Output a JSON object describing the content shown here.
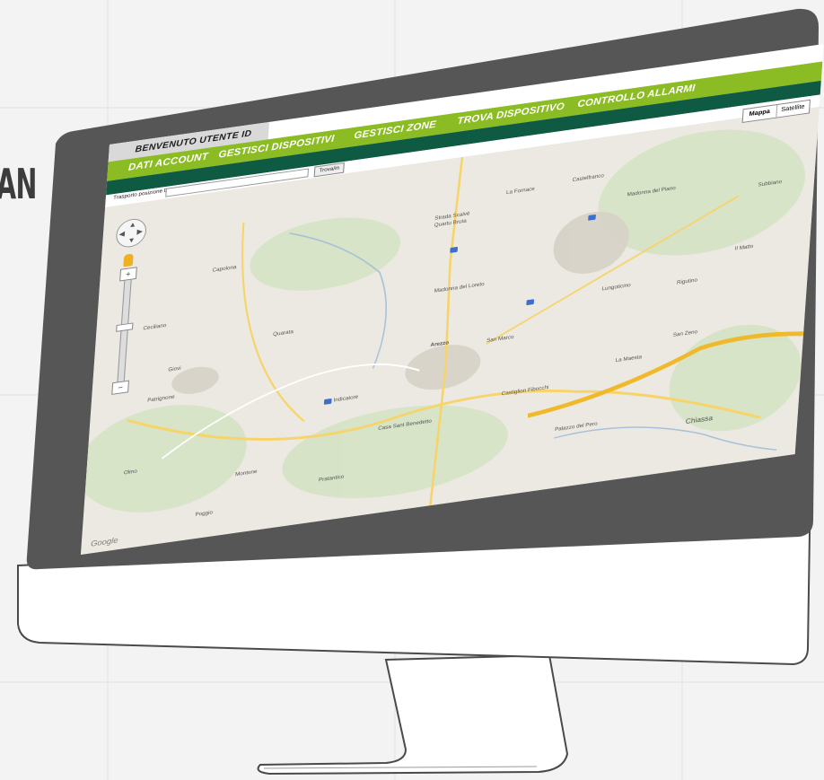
{
  "side_text": "AN",
  "header": {
    "welcome": "BENVENUTO UTENTE ID",
    "nav": [
      {
        "label": "DATI ACCOUNT"
      },
      {
        "label": "GESTISCI DISPOSITIVI"
      },
      {
        "label": "GESTISCI ZONE"
      },
      {
        "label": "TROVA DISPOSITIVO"
      },
      {
        "label": "CONTROLLO ALLARMI"
      }
    ]
  },
  "search": {
    "label": "Trasporto posizione Da",
    "button": "Trova/in"
  },
  "map_type": {
    "map": "Mappa",
    "satellite": "Satellite"
  },
  "map": {
    "attribution": "Google",
    "places": [
      "La Fornace",
      "Castelfranco",
      "Strada Scalvé",
      "Quartu Bruta",
      "Madonna del Piano",
      "Madonna del Loreto",
      "Arezzo",
      "San Marco",
      "Lungoticino",
      "Casa Sant Benedetto",
      "Chiassa",
      "Rigutino",
      "Poggio",
      "Capolona",
      "Giovi",
      "Montone",
      "La Maesta",
      "San Zeno",
      "Pratantico",
      "Olmo",
      "Ceciliano",
      "Patrignone",
      "Quarata",
      "Indicatore",
      "Il Matto",
      "Palazzo del Pero",
      "Castiglion Fibocchi",
      "Subbiano"
    ]
  },
  "colors": {
    "green": "#8cbc23",
    "dark_green": "#0e5a43",
    "frame": "#555555"
  }
}
